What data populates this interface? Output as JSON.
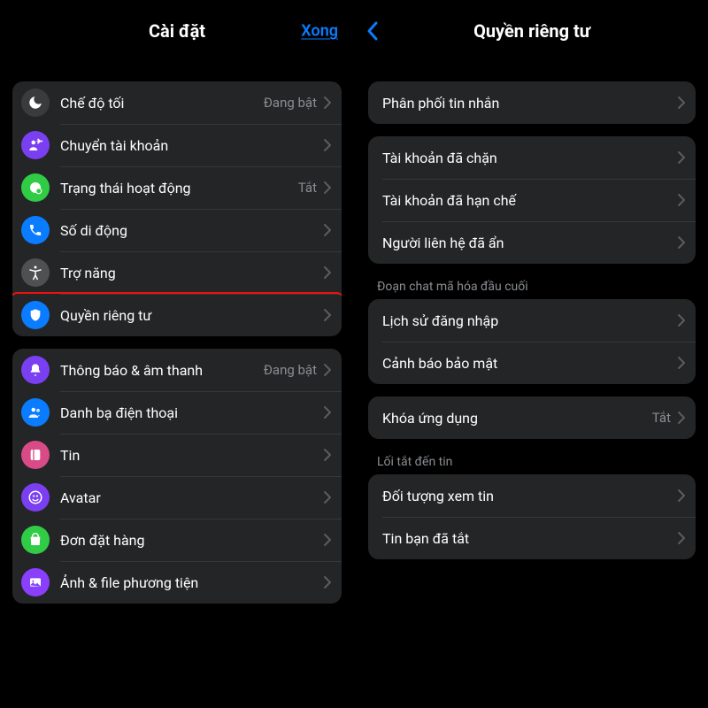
{
  "left": {
    "title": "Cài đặt",
    "done": "Xong",
    "groups": [
      [
        {
          "icon": "moon",
          "bg": "bg-darkgray",
          "label": "Chế độ tối",
          "value": "Đang bật"
        },
        {
          "icon": "switchaccount",
          "bg": "bg-purple",
          "label": "Chuyển tài khoản",
          "value": ""
        },
        {
          "icon": "active",
          "bg": "bg-green",
          "label": "Trạng thái hoạt động",
          "value": "Tắt"
        },
        {
          "icon": "phone",
          "bg": "bg-blue",
          "label": "Số di động",
          "value": ""
        },
        {
          "icon": "accessibility",
          "bg": "bg-gray",
          "label": "Trợ năng",
          "value": ""
        },
        {
          "icon": "shield",
          "bg": "bg-blue",
          "label": "Quyền riêng tư",
          "value": ""
        }
      ],
      [
        {
          "icon": "bell",
          "bg": "bg-purple",
          "label": "Thông báo & âm thanh",
          "value": "Đang bật"
        },
        {
          "icon": "contacts",
          "bg": "bg-blue",
          "label": "Danh bạ điện thoại",
          "value": ""
        },
        {
          "icon": "story",
          "bg": "bg-pink",
          "label": "Tin",
          "value": ""
        },
        {
          "icon": "avatar",
          "bg": "bg-purple",
          "label": "Avatar",
          "value": ""
        },
        {
          "icon": "orders",
          "bg": "bg-green",
          "label": "Đơn đặt hàng",
          "value": ""
        },
        {
          "icon": "media",
          "bg": "bg-purple2",
          "label": "Ảnh & file phương tiện",
          "value": ""
        }
      ]
    ]
  },
  "right": {
    "title": "Quyền riêng tư",
    "sections": [
      {
        "header": "",
        "rows": [
          {
            "label": "Phân phối tin nhắn",
            "value": ""
          }
        ]
      },
      {
        "header": "",
        "rows": [
          {
            "label": "Tài khoản đã chặn",
            "value": ""
          },
          {
            "label": "Tài khoản đã hạn chế",
            "value": ""
          },
          {
            "label": "Người liên hệ đã ẩn",
            "value": ""
          }
        ]
      },
      {
        "header": "Đoạn chat mã hóa đầu cuối",
        "rows": [
          {
            "label": "Lịch sử đăng nhập",
            "value": ""
          },
          {
            "label": "Cảnh báo bảo mật",
            "value": ""
          }
        ]
      },
      {
        "header": "",
        "rows": [
          {
            "label": "Khóa ứng dụng",
            "value": "Tắt"
          }
        ]
      },
      {
        "header": "Lối tắt đến tin",
        "rows": [
          {
            "label": "Đối tượng xem tin",
            "value": ""
          },
          {
            "label": "Tin bạn đã tắt",
            "value": ""
          }
        ]
      }
    ]
  }
}
